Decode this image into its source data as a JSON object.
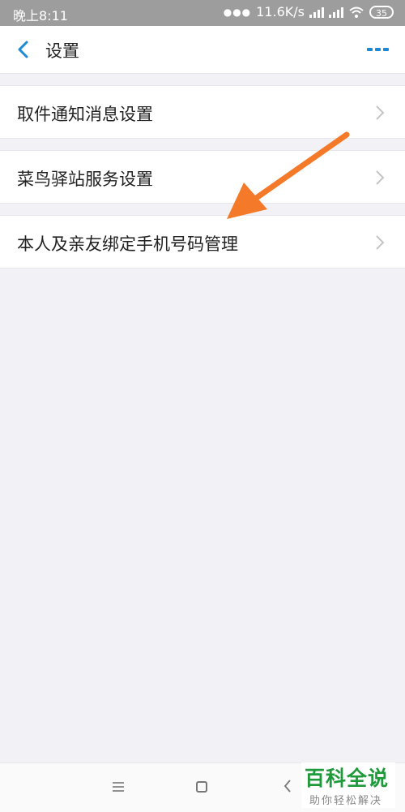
{
  "status_bar": {
    "time": "晚上8:11",
    "network_speed": "11.6K/s",
    "battery": "35"
  },
  "header": {
    "title": "设置",
    "back_icon": "chevron-left-icon",
    "more_icon": "more-dots-icon",
    "accent_color": "#1a8ad6"
  },
  "settings_items": [
    {
      "label": "取件通知消息设置"
    },
    {
      "label": "菜鸟驿站服务设置"
    },
    {
      "label": "本人及亲友绑定手机号码管理"
    }
  ],
  "annotation": {
    "arrow_color": "#f47a2a",
    "icon": "arrow-annotation-icon"
  },
  "navigation_bar": {
    "menu_icon": "menu-icon",
    "home_icon": "home-square-icon",
    "back_icon": "back-triangle-icon"
  },
  "watermark": {
    "title": "百科全说",
    "subtitle": "助你轻松解决",
    "color": "#1e9a3a"
  }
}
